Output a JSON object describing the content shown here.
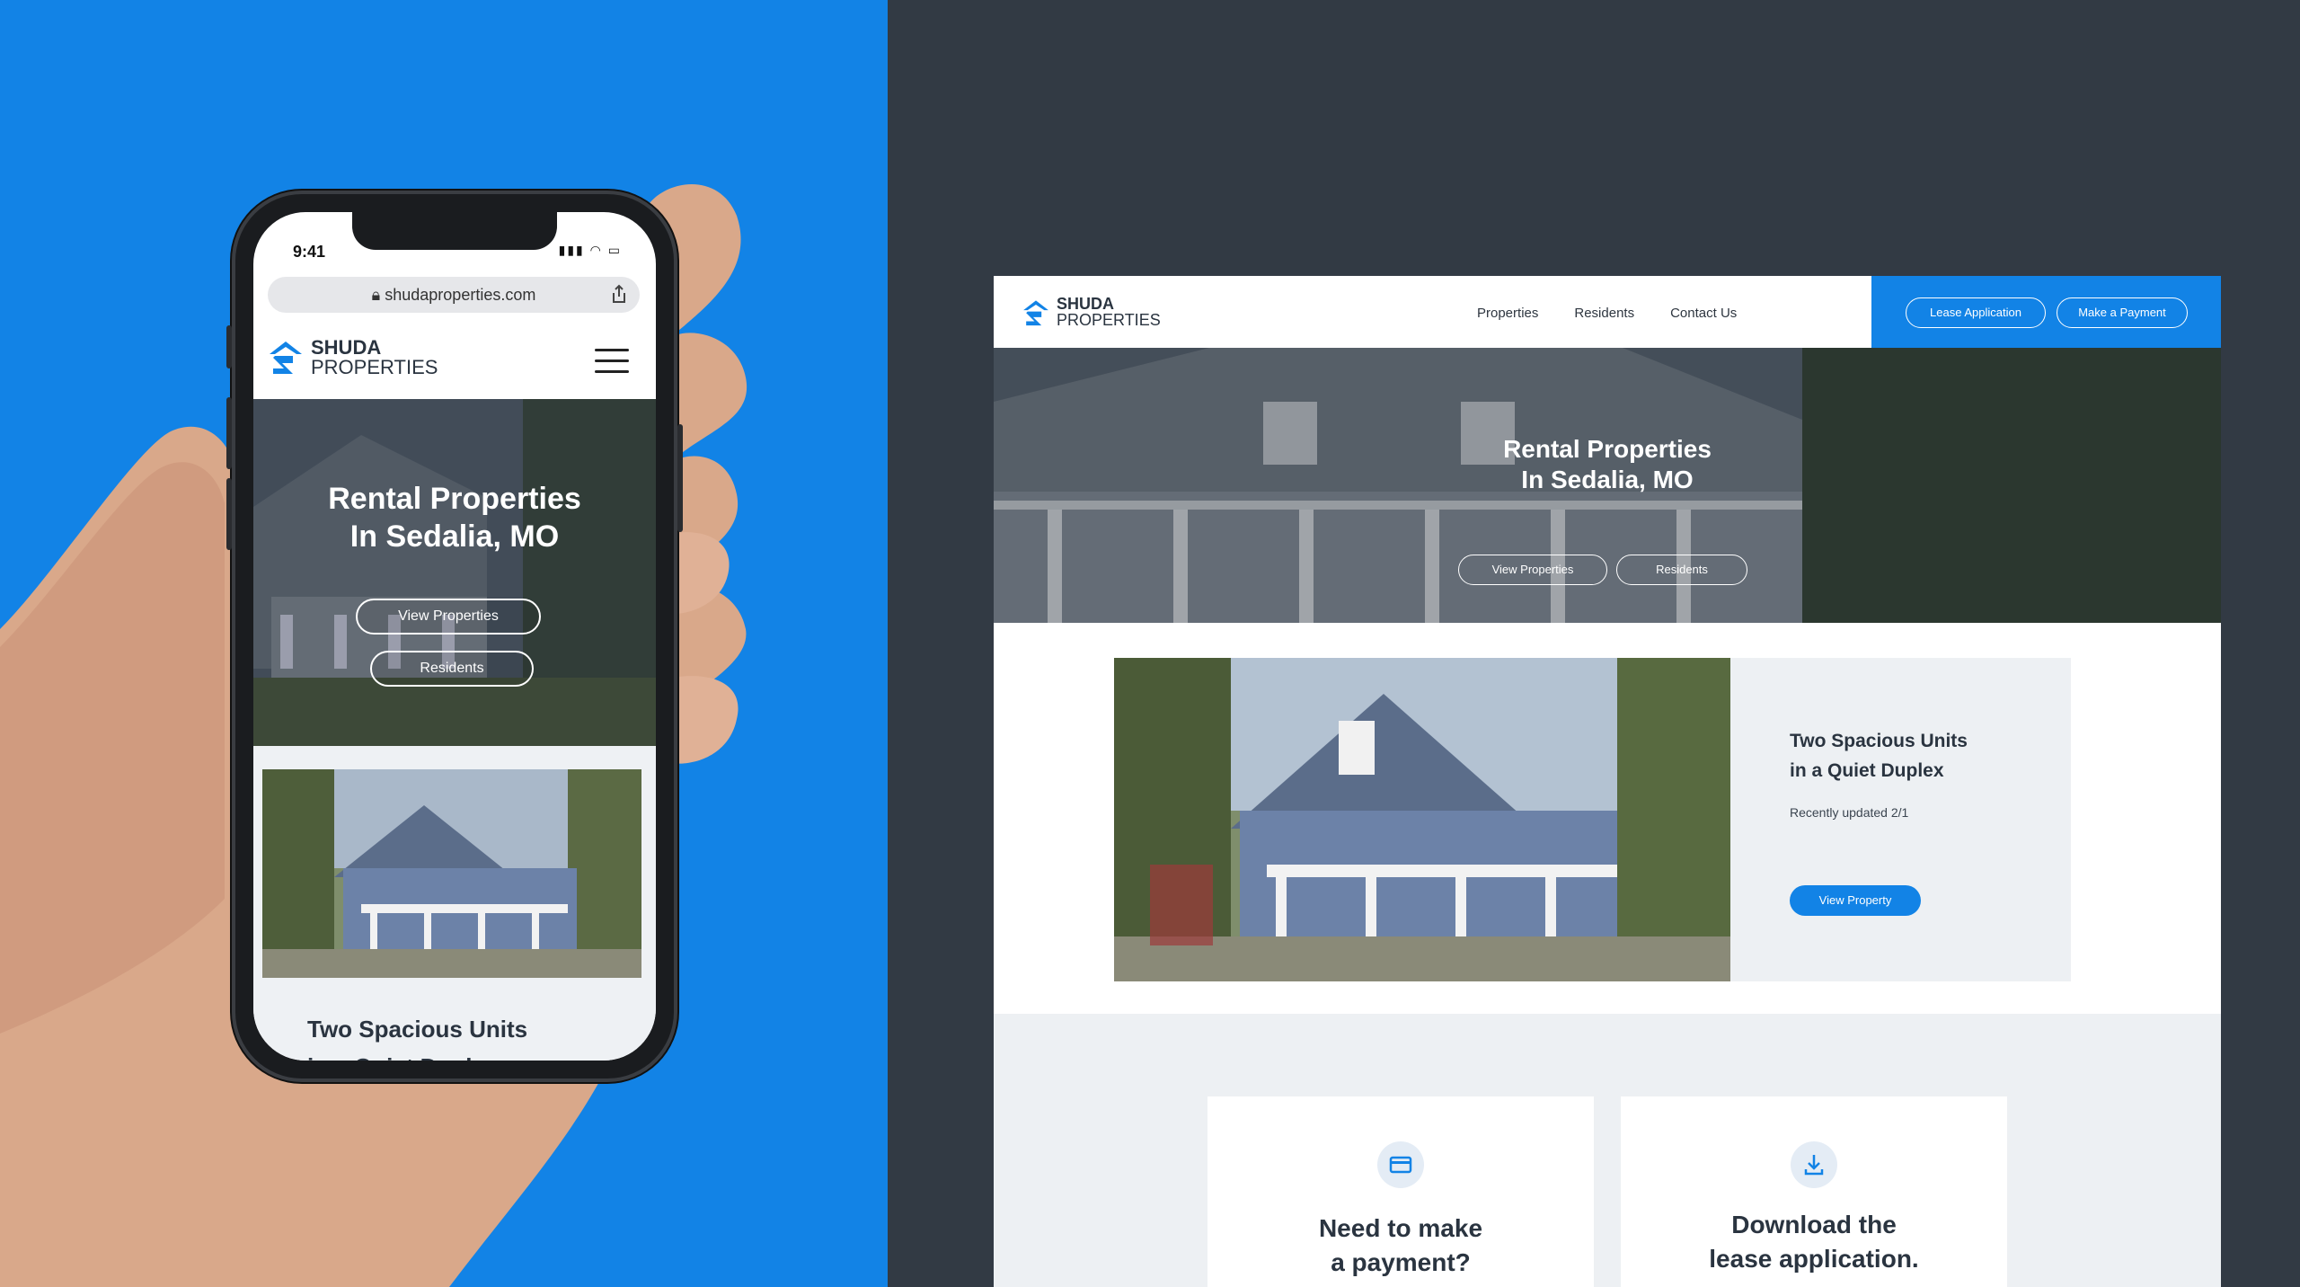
{
  "colors": {
    "brand_blue": "#1283e6",
    "dark_bg": "#323a44",
    "text_dark": "#2a3440",
    "panel_gray": "#edf0f3"
  },
  "brand": {
    "name_top": "SHUDA",
    "name_bottom": "PROPERTIES"
  },
  "mobile": {
    "status_time": "9:41",
    "url": "shudaproperties.com",
    "hero_title_line1": "Rental Properties",
    "hero_title_line2": "In Sedalia, MO",
    "btn_view_properties": "View Properties",
    "btn_residents": "Residents",
    "card_title_line1": "Two Spacious Units",
    "card_title_line2": "in a Quiet Duplex"
  },
  "desktop": {
    "nav": [
      "Properties",
      "Residents",
      "Contact Us"
    ],
    "cta_lease": "Lease Application",
    "cta_payment": "Make a Payment",
    "hero_title_line1": "Rental Properties",
    "hero_title_line2": "In Sedalia, MO",
    "btn_view_properties": "View Properties",
    "btn_residents": "Residents",
    "feature_title_line1": "Two Spacious Units",
    "feature_title_line2": "in a Quiet Duplex",
    "feature_updated": "Recently updated 2/1",
    "feature_button": "View Property",
    "card_payment_line1": "Need to make",
    "card_payment_line2": "a payment?",
    "card_download_line1": "Download the",
    "card_download_line2": "lease application."
  }
}
